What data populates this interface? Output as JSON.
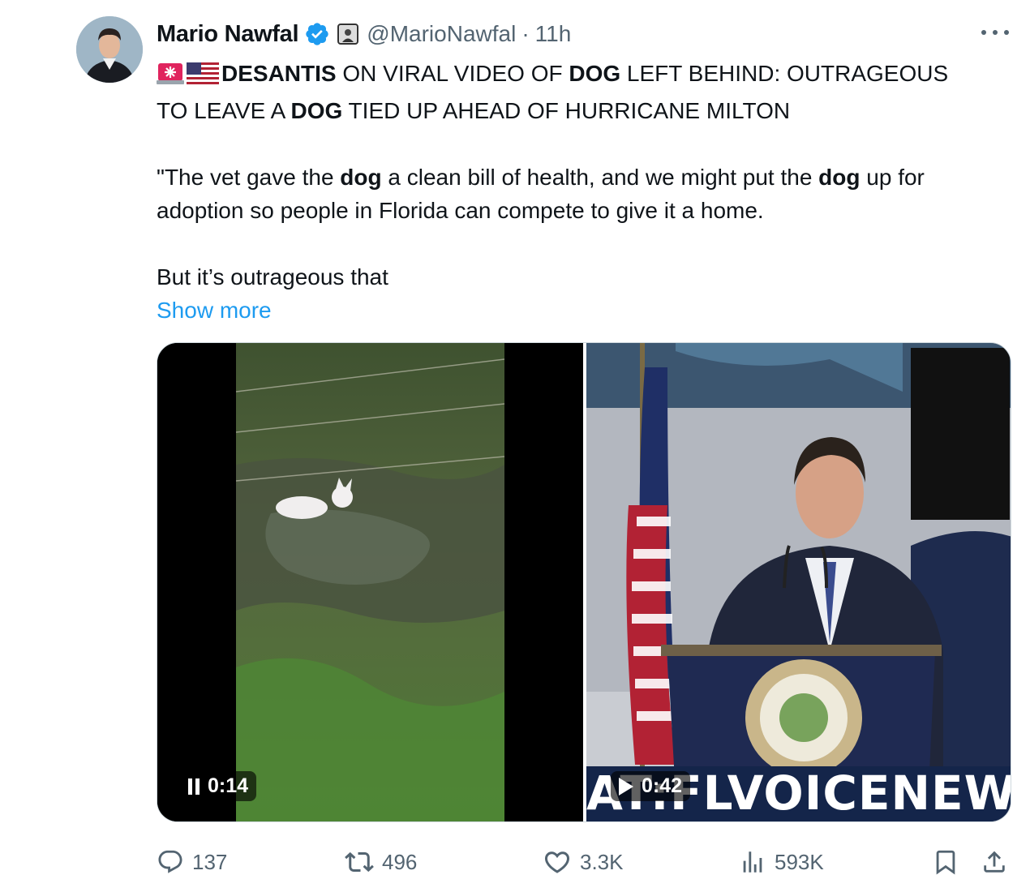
{
  "author": {
    "name": "Mario Nawfal",
    "handle": "@MarioNawfal",
    "separator": "·",
    "time": "11h"
  },
  "tweet": {
    "headline": [
      {
        "t": "DESANTIS",
        "b": true
      },
      {
        "t": " ON VIRAL VIDEO OF ",
        "b": false
      },
      {
        "t": "DOG",
        "b": true
      },
      {
        "t": " LEFT BEHIND: OUTRAGEOUS",
        "b": false
      }
    ],
    "headline2": [
      {
        "t": "TO LEAVE A ",
        "b": false
      },
      {
        "t": "DOG",
        "b": true
      },
      {
        "t": " TIED UP AHEAD OF HURRICANE MILTON",
        "b": false
      }
    ],
    "quote1": [
      {
        "t": "\"The vet gave the ",
        "b": false
      },
      {
        "t": "dog",
        "b": true
      },
      {
        "t": " a clean bill of health, and we might put the ",
        "b": false
      },
      {
        "t": "dog",
        "b": true
      },
      {
        "t": " up for",
        "b": false
      }
    ],
    "quote2": "adoption so people in Florida can compete to give it a home.",
    "quote3": "But it’s outrageous that",
    "show_more": "Show more"
  },
  "media": {
    "left_video_time": "0:14",
    "right_video_time": "0:42",
    "banner_text": "AT:FLVOICENEW"
  },
  "actions": {
    "replies": "137",
    "reposts": "496",
    "likes": "3.3K",
    "views": "593K"
  },
  "icons": [
    "verified-badge-icon",
    "affiliate-badge-icon",
    "more-icon",
    "siren-emoji-icon",
    "us-flag-emoji-icon",
    "pause-icon",
    "play-icon",
    "reply-icon",
    "repost-icon",
    "like-icon",
    "views-icon",
    "bookmark-icon",
    "share-icon"
  ],
  "colors": {
    "accent": "#1d9bf0",
    "secondary_text": "#536471",
    "verified": "#1d9bf0",
    "banner_bg": "#14254a"
  }
}
